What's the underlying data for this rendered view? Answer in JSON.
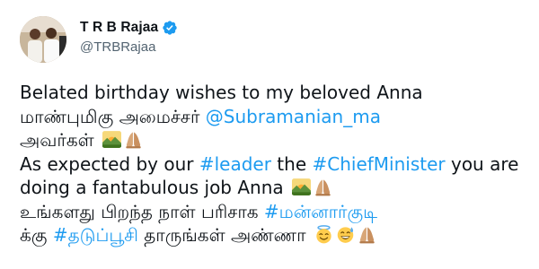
{
  "tweet": {
    "author": {
      "name": "T R B Rajaa",
      "handle": "@TRBRajaa"
    },
    "lines": {
      "l1": "Belated birthday wishes to my beloved Anna",
      "l2_text": "மாண்புமிகு அமைச்சர் ",
      "l2_mention": "@Subramanian_ma",
      "l3_text": "அவர்கள் ",
      "l4_a": "As expected by our ",
      "l4_tag1": "#leader",
      "l4_b": " the ",
      "l4_tag2": "#ChiefMinister",
      "l4_c": " you are",
      "l5_text": "doing a fantabulous job Anna ",
      "l6_text": "உங்களது பிறந்த நாள் பரிசாக ",
      "l6_tag": "#மன்னார்குடி",
      "l7_a": "க்கு ",
      "l7_tag": "#தடுப்பூசி",
      "l7_b": " தாருங்கள் அண்ணா "
    },
    "emojis": [
      "sunrise-over-mountains",
      "folded-hands",
      "sunrise-over-mountains",
      "folded-hands",
      "smiling-face-with-halo",
      "grinning-face-with-sweat",
      "folded-hands"
    ],
    "colors": {
      "link": "#1d9bf0",
      "text": "#0f1419",
      "secondary": "#536471",
      "verified": "#1d9bf0"
    }
  }
}
